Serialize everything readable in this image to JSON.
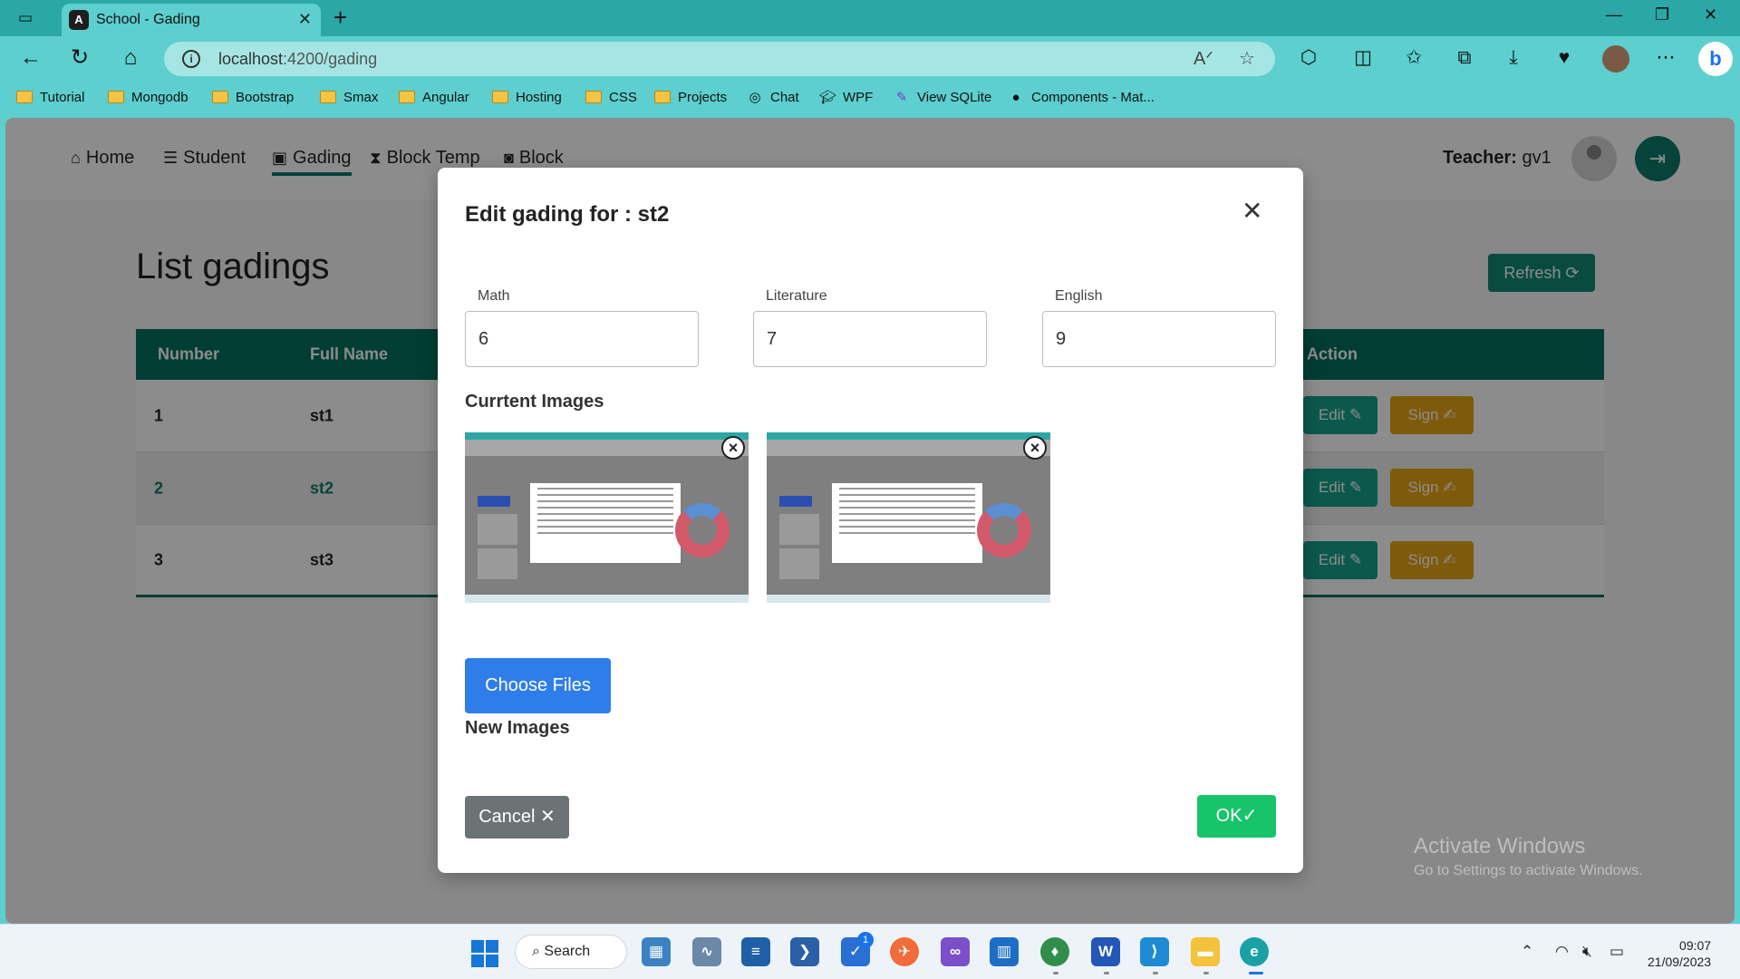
{
  "browser": {
    "tab_title": "School - Gading",
    "tab_icon": "A",
    "url_host": "localhost",
    "url_path": ":4200/gading",
    "bookmarks": [
      {
        "label": "Tutorial",
        "icon": "folder"
      },
      {
        "label": "Mongodb",
        "icon": "folder"
      },
      {
        "label": "Bootstrap",
        "icon": "folder"
      },
      {
        "label": "Smax",
        "icon": "folder"
      },
      {
        "label": "Angular",
        "icon": "folder"
      },
      {
        "label": "Hosting",
        "icon": "folder"
      },
      {
        "label": "CSS",
        "icon": "folder"
      },
      {
        "label": "Projects",
        "icon": "folder"
      },
      {
        "label": "Chat",
        "icon": "chat-icon"
      },
      {
        "label": "WPF",
        "icon": "mortarboard-icon"
      },
      {
        "label": "View SQLite",
        "icon": "feather-icon"
      },
      {
        "label": "Components - Mat...",
        "icon": "github-icon"
      }
    ]
  },
  "app_nav": {
    "items": [
      {
        "label": "Home",
        "icon": "home-icon"
      },
      {
        "label": "Student",
        "icon": "list-icon"
      },
      {
        "label": "Gading",
        "icon": "book-icon"
      },
      {
        "label": "Block Temp",
        "icon": "hourglass-icon"
      },
      {
        "label": "Block",
        "icon": "box-icon"
      }
    ],
    "active": "Gading",
    "teacher_label": "Teacher:",
    "teacher_name": "gv1"
  },
  "page": {
    "title": "List gadings",
    "refresh_label": "Refresh"
  },
  "table": {
    "headers": [
      "Number",
      "Full Name",
      "Action"
    ],
    "rows": [
      {
        "number": "1",
        "name": "st1"
      },
      {
        "number": "2",
        "name": "st2"
      },
      {
        "number": "3",
        "name": "st3"
      }
    ],
    "edit_label": "Edit",
    "sign_label": "Sign"
  },
  "modal": {
    "title": "Edit gading for : st2",
    "fields": [
      {
        "label": "Math",
        "value": "6"
      },
      {
        "label": "Literature",
        "value": "7"
      },
      {
        "label": "English",
        "value": "9"
      }
    ],
    "current_images_label": "Currtent Images",
    "current_images_count": 2,
    "choose_files_label": "Choose Files",
    "new_images_label": "New Images",
    "cancel_label": "Cancel",
    "ok_label": "OK"
  },
  "watermark": {
    "line1": "Activate Windows",
    "line2": "Go to Settings to activate Windows."
  },
  "taskbar": {
    "search_label": "Search",
    "time": "09:07",
    "date": "21/09/2023",
    "badge": "1"
  },
  "colors": {
    "primary_teal": "#00705e",
    "edit_button": "#14a08a",
    "sign_button": "#e6a514",
    "choose_files": "#2f7dea",
    "ok_button": "#18c46a",
    "cancel_button": "#6c7374",
    "browser_chrome": "#5ccfce"
  }
}
